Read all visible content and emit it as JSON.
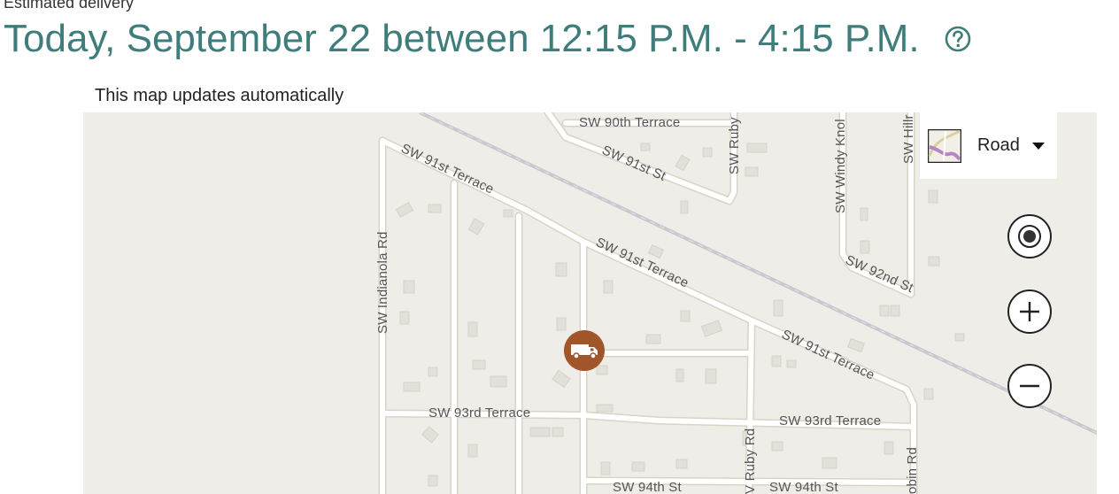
{
  "header": {
    "estimated_label": "Estimated delivery",
    "delivery_window": "Today, September 22 between 12:15 P.M. - 4:15 P.M."
  },
  "map": {
    "note": "This map updates automatically",
    "map_type": {
      "selected": "Road"
    },
    "streets": {
      "sw_90th_terrace": "SW 90th Terrace",
      "sw_91st_st": "SW 91st St",
      "sw_ruby": "SW Ruby",
      "sw_windy_knoll": "SW Windy Knol",
      "sw_hill": "SW Hillr",
      "sw_91st_terrace_1": "SW 91st Terrace",
      "sw_91st_terrace_2": "SW 91st Terrace",
      "sw_91st_terrace_3": "SW 91st Terrace",
      "sw_92nd_st": "SW 92nd St",
      "sw_indianola_rd": "SW Indianola Rd",
      "sw_93rd_terrace_1": "SW 93rd Terrace",
      "sw_93rd_terrace_2": "SW 93rd Terrace",
      "sw_94th_st_1": "SW 94th St",
      "sw_94th_st_2": "SW 94th St",
      "sw_ruby_rd": "V Ruby Rd",
      "sw_robin_rd": "obin Rd"
    },
    "colors": {
      "land": "#efede8",
      "road": "#ffffff",
      "road_edge": "#d9d4c7",
      "rail": "#c9c8cf",
      "building": "#e3e0d9",
      "vehicle": "#a0552a",
      "headline": "#3f7d7b"
    },
    "icons": {
      "vehicle": "delivery-truck-icon",
      "help": "question-mark-circle-icon",
      "locate": "locate-me-icon",
      "zoom_in": "plus-icon",
      "zoom_out": "minus-icon"
    }
  }
}
